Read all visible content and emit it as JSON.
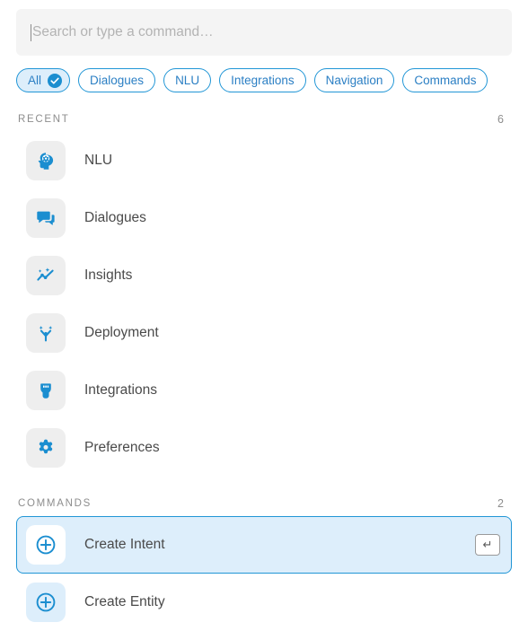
{
  "search": {
    "placeholder": "Search or type a command…",
    "value": ""
  },
  "filters": [
    {
      "label": "All",
      "active": true,
      "icon": "check-circle-icon"
    },
    {
      "label": "Dialogues",
      "active": false
    },
    {
      "label": "NLU",
      "active": false
    },
    {
      "label": "Integrations",
      "active": false
    },
    {
      "label": "Navigation",
      "active": false
    },
    {
      "label": "Commands",
      "active": false
    }
  ],
  "sections": [
    {
      "title": "RECENT",
      "count": "6",
      "items": [
        {
          "label": "NLU",
          "icon": "brain-head-gear-icon"
        },
        {
          "label": "Dialogues",
          "icon": "chat-bubbles-icon"
        },
        {
          "label": "Insights",
          "icon": "trend-sparkline-icon"
        },
        {
          "label": "Deployment",
          "icon": "branch-fork-icon"
        },
        {
          "label": "Integrations",
          "icon": "plug-connector-icon"
        },
        {
          "label": "Preferences",
          "icon": "gear-icon"
        }
      ]
    },
    {
      "title": "COMMANDS",
      "count": "2",
      "items": [
        {
          "label": "Create Intent",
          "icon": "plus-circle-icon",
          "selected": true,
          "shortcut": "↵"
        },
        {
          "label": "Create Entity",
          "icon": "plus-circle-icon",
          "selected": false
        }
      ]
    }
  ],
  "colors": {
    "accent": "#1b8ed0",
    "accent_border": "#2196d6",
    "selected_bg": "#ddeefb",
    "tile_bg": "#eeeeee",
    "text": "#4a4a4a",
    "muted": "#8d8d8d",
    "search_bg": "#f4f4f4"
  }
}
